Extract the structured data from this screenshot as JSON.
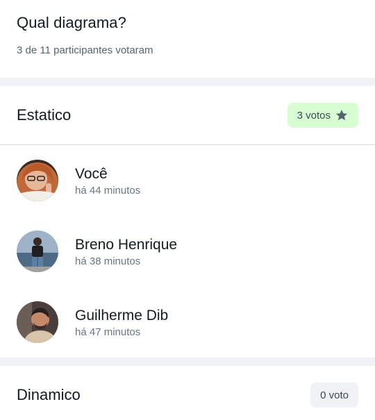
{
  "poll": {
    "title": "Qual diagrama?",
    "subtitle": "3 de 11 participantes votaram"
  },
  "options": [
    {
      "title": "Estatico",
      "votes_label": "3 votos",
      "winner_icon": "star-icon",
      "voters": [
        {
          "name": "Você",
          "time": "há 44 minutos"
        },
        {
          "name": "Breno Henrique",
          "time": "há 38 minutos"
        },
        {
          "name": "Guilherme Dib",
          "time": "há 47 minutos"
        }
      ]
    },
    {
      "title": "Dinamico",
      "votes_label": "0 voto"
    }
  ],
  "colors": {
    "accent_bg": "#d9fdd3",
    "neutral_bg": "#f0f2f5",
    "section_gap": "#f0f2f5",
    "star": "#54656f"
  }
}
